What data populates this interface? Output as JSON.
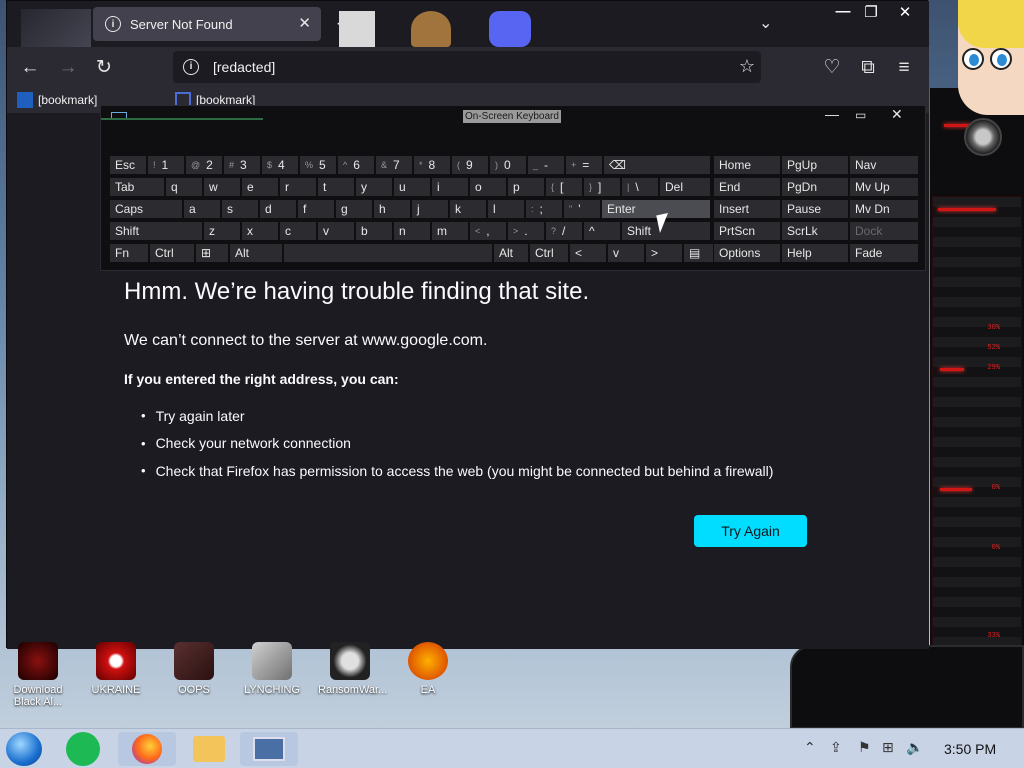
{
  "browser": {
    "tab_title": "Server Not Found",
    "url_value": "[redacted]",
    "bookmarks": [
      "[bookmark]",
      "[bookmark]"
    ]
  },
  "error_page": {
    "title": "Hmm. We’re having trouble finding that site.",
    "subtitle": "We can’t connect to the server at www.google.com.",
    "hint": "If you entered the right address, you can:",
    "items": [
      "Try again later",
      "Check your network connection",
      "Check that Firefox has permission to access the web (you might be connected but behind a firewall)"
    ],
    "button": "Try Again"
  },
  "osk": {
    "title": "On-Screen Keyboard",
    "row1": [
      "Esc",
      "1",
      "2",
      "3",
      "4",
      "5",
      "6",
      "7",
      "8",
      "9",
      "0",
      "-",
      "=",
      "⌫"
    ],
    "row1_sup": [
      "~ `",
      "!",
      "@",
      "#",
      "$",
      "%",
      "^",
      "&",
      "*",
      "(",
      ")",
      "_",
      "+"
    ],
    "row2": [
      "Tab",
      "q",
      "w",
      "e",
      "r",
      "t",
      "y",
      "u",
      "i",
      "o",
      "p",
      "[",
      "]",
      "\\",
      "Del"
    ],
    "row2_sup": [
      "{",
      "}",
      "|"
    ],
    "row3": [
      "Caps",
      "a",
      "s",
      "d",
      "f",
      "g",
      "h",
      "j",
      "k",
      "l",
      ";",
      "'",
      "Enter"
    ],
    "row3_sup": [
      ":",
      "\""
    ],
    "row4": [
      "Shift",
      "z",
      "x",
      "c",
      "v",
      "b",
      "n",
      "m",
      ",",
      ".",
      "/",
      "^",
      "Shift"
    ],
    "row4_sup": [
      "<",
      ">",
      "?"
    ],
    "row5": [
      "Fn",
      "Ctrl",
      "⊞",
      "Alt",
      "Alt",
      "Ctrl",
      "<",
      "v",
      ">",
      "▤"
    ],
    "nav": [
      [
        "Home",
        "PgUp",
        "Nav"
      ],
      [
        "End",
        "PgDn",
        "Mv Up"
      ],
      [
        "Insert",
        "Pause",
        "Mv Dn"
      ],
      [
        "PrtScn",
        "ScrLk",
        "Dock"
      ],
      [
        "Options",
        "Help",
        "Fade"
      ]
    ]
  },
  "desktop_icons": [
    "Download Black Al...",
    "UKRAINE",
    "OOPS",
    "LYNCHING",
    "RansomWar...",
    "EA"
  ],
  "taskbar": {
    "clock": "3:50 PM"
  },
  "colors": {
    "accent": "#00ddff",
    "page_bg": "#1c1b22",
    "toolbar": "#2b2a33",
    "tab": "#42414d"
  }
}
